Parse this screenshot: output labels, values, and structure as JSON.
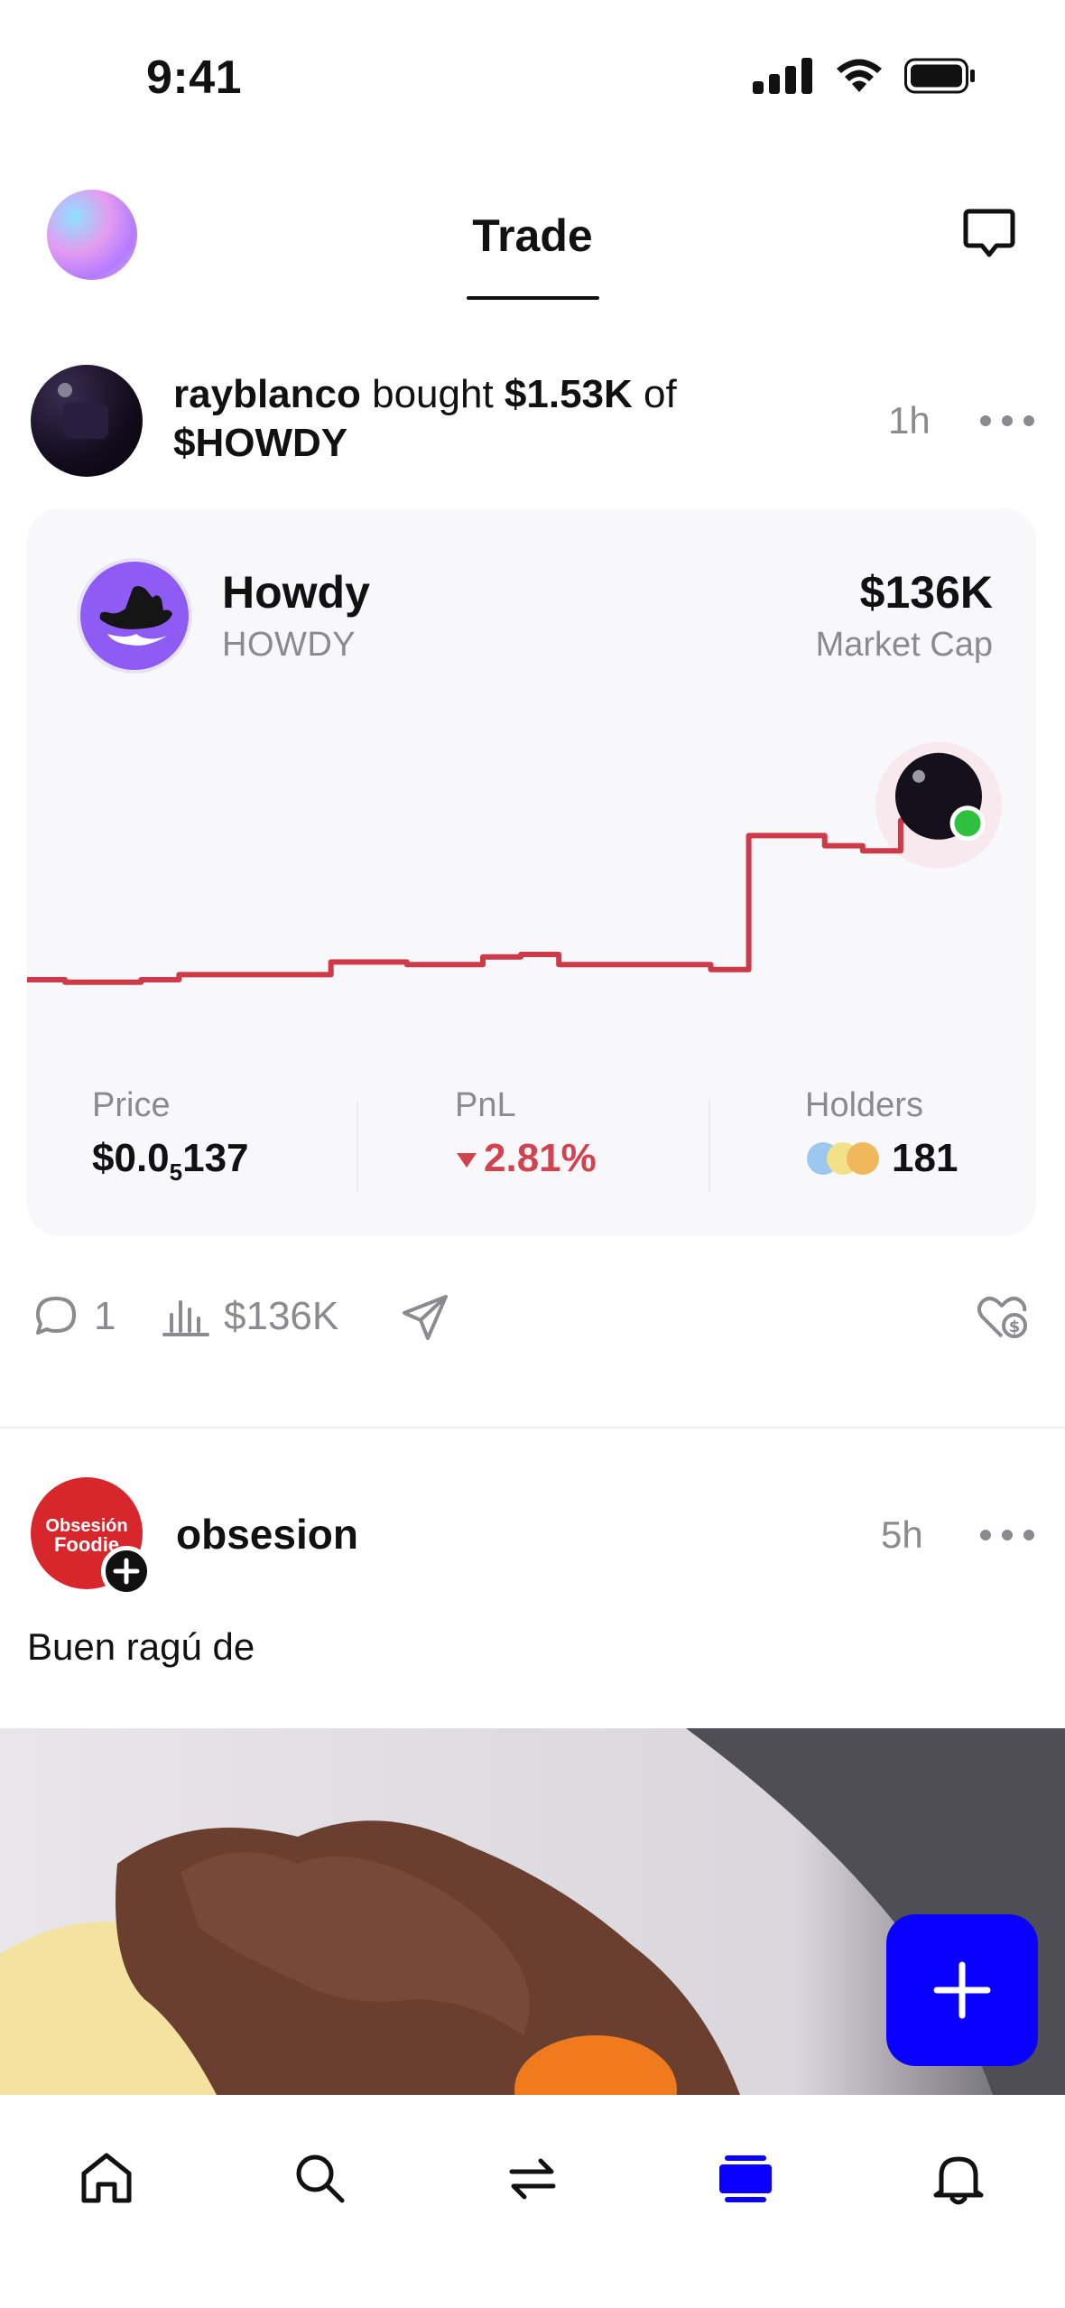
{
  "status": {
    "time": "9:41"
  },
  "nav": {
    "title": "Trade"
  },
  "post1": {
    "user": "rayblanco",
    "verb": "bought",
    "amount": "$1.53K",
    "of": "of",
    "ticker": "$HOWDY",
    "time": "1h"
  },
  "token": {
    "name": "Howdy",
    "ticker": "HOWDY",
    "market_cap": "$136K",
    "market_cap_label": "Market Cap"
  },
  "stats": {
    "price_label": "Price",
    "price_value_prefix": "$0.0",
    "price_value_sub": "5",
    "price_value_suffix": "137",
    "pnl_label": "PnL",
    "pnl_value": "2.81%",
    "holders_label": "Holders",
    "holders_value": "181"
  },
  "chart_data": {
    "type": "line",
    "title": "",
    "xlabel": "",
    "ylabel": "",
    "x": [
      0,
      1,
      2,
      3,
      4,
      5,
      6,
      7,
      8,
      9,
      10,
      11,
      12,
      13,
      14,
      15,
      16,
      17,
      18,
      19,
      20,
      21,
      22,
      23,
      24
    ],
    "y": [
      10,
      9,
      9,
      10,
      12,
      12,
      12,
      12,
      17,
      17,
      16,
      16,
      19,
      20,
      16,
      16,
      16,
      16,
      14,
      67,
      67,
      63,
      61,
      73,
      79
    ],
    "ylim": [
      0,
      100
    ],
    "grid": false,
    "series_color": "#cf3a49"
  },
  "actions": {
    "comments": "1",
    "volume": "$136K"
  },
  "post2": {
    "user": "obsesion",
    "time": "5h",
    "caption": "Buen ragú de",
    "avatar_text": "Obsesión Foodie"
  },
  "colors": {
    "accent": "#0a00ff",
    "negative": "#d0434f",
    "muted": "#8a8a8f"
  },
  "tabs": [
    "home-icon",
    "search-icon",
    "swap-icon",
    "feed-icon",
    "bell-icon"
  ]
}
